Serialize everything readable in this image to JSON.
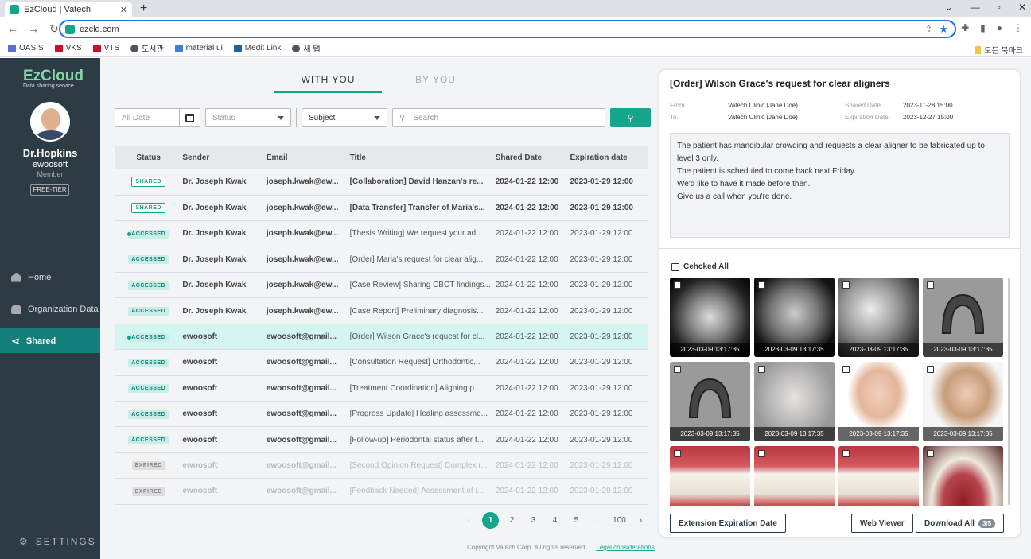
{
  "browser": {
    "tab_title": "EzCloud | Vatech",
    "url": "ezcld.com",
    "bookmarks": [
      "OASIS",
      "VKS",
      "VTS",
      "도서관",
      "material ui",
      "Medit Link",
      "새 탭"
    ],
    "bookmarks_right": "모든 북마크"
  },
  "sidebar": {
    "logo": "EzCloud",
    "tagline": "Data sharing service",
    "user_name": "Dr.Hopkins",
    "user_id": "ewoosoft",
    "role": "Member",
    "tier": "FREE-TIER",
    "nav": [
      {
        "label": "Home",
        "icon": "home-icon"
      },
      {
        "label": "Organization Data",
        "icon": "cloud-upload-icon"
      },
      {
        "label": "Shared",
        "icon": "share-icon",
        "active": true
      }
    ],
    "settings": "SETTINGS"
  },
  "main": {
    "tabs": [
      "WITH YOU",
      "BY YOU"
    ],
    "filters": {
      "date_placeholder": "All Date",
      "status": "Status",
      "subject": "Subject",
      "search_placeholder": "Search"
    },
    "columns": [
      "Status",
      "Sender",
      "Email",
      "Title",
      "Shared Date",
      "Expiration date"
    ],
    "rows": [
      {
        "status": "SHARED",
        "sender": "Dr. Joseph Kwak",
        "email": "joseph.kwak@ew...",
        "title": "[Collaboration] David Hanzan's re...",
        "shared": "2024-01-22 12:00",
        "exp": "2023-01-29 12:00",
        "bold": true
      },
      {
        "status": "SHARED",
        "sender": "Dr. Joseph Kwak",
        "email": "joseph.kwak@ew...",
        "title": "[Data Transfer] Transfer of Maria's...",
        "shared": "2024-01-22 12:00",
        "exp": "2023-01-29 12:00",
        "bold": true
      },
      {
        "status": "ACCESSED",
        "sender": "Dr. Joseph Kwak",
        "email": "joseph.kwak@ew...",
        "title": "[Thesis Writing] We request your ad...",
        "shared": "2024-01-22 12:00",
        "exp": "2023-01-29 12:00",
        "dot": true
      },
      {
        "status": "ACCESSED",
        "sender": "Dr. Joseph Kwak",
        "email": "joseph.kwak@ew...",
        "title": "[Order] Maria's request for clear alig...",
        "shared": "2024-01-22 12:00",
        "exp": "2023-01-29 12:00"
      },
      {
        "status": "ACCESSED",
        "sender": "Dr. Joseph Kwak",
        "email": "joseph.kwak@ew...",
        "title": "[Case Review] Sharing CBCT findings...",
        "shared": "2024-01-22 12:00",
        "exp": "2023-01-29 12:00"
      },
      {
        "status": "ACCESSED",
        "sender": "Dr. Joseph Kwak",
        "email": "joseph.kwak@ew...",
        "title": "[Case Report] Preliminary diagnosis...",
        "shared": "2024-01-22 12:00",
        "exp": "2023-01-29 12:00"
      },
      {
        "status": "ACCESSED",
        "sender": "ewoosoft",
        "email": "ewoosoft@gmail...",
        "title": "[Order] Wilson Grace's request for cl...",
        "shared": "2024-01-22 12:00",
        "exp": "2023-01-29 12:00",
        "dot": true,
        "selected": true
      },
      {
        "status": "ACCESSED",
        "sender": "ewoosoft",
        "email": "ewoosoft@gmail...",
        "title": "[Consultation Request] Orthodontic...",
        "shared": "2024-01-22 12:00",
        "exp": "2023-01-29 12:00"
      },
      {
        "status": "ACCESSED",
        "sender": "ewoosoft",
        "email": "ewoosoft@gmail...",
        "title": "[Treatment Coordination] Aligning p...",
        "shared": "2024-01-22 12:00",
        "exp": "2023-01-29 12:00"
      },
      {
        "status": "ACCESSED",
        "sender": "ewoosoft",
        "email": "ewoosoft@gmail...",
        "title": "[Progress Update] Healing assessme...",
        "shared": "2024-01-22 12:00",
        "exp": "2023-01-29 12:00"
      },
      {
        "status": "ACCESSED",
        "sender": "ewoosoft",
        "email": "ewoosoft@gmail...",
        "title": "[Follow-up] Periodontal status after f...",
        "shared": "2024-01-22 12:00",
        "exp": "2023-01-29 12:00"
      },
      {
        "status": "EXPIRED",
        "sender": "ewoosoft",
        "email": "ewoosoft@gmail...",
        "title": "[Second Opinion Request] Complex r...",
        "shared": "2024-01-22 12:00",
        "exp": "2023-01-29 12:00"
      },
      {
        "status": "EXPIRED",
        "sender": "ewoosoft",
        "email": "ewoosoft@gmail...",
        "title": "[Feedback Needed] Assessment of i...",
        "shared": "2024-01-22 12:00",
        "exp": "2023-01-29 12:00"
      }
    ],
    "pagination": [
      "1",
      "2",
      "3",
      "4",
      "5",
      "...",
      "100"
    ],
    "footer_copy": "Copyright Vatech Corp. All rights reserved",
    "footer_link": "Legal considerations"
  },
  "detail": {
    "title": "[Order] Wilson Grace's request for clear aligners",
    "from_label": "From.",
    "from": "Vatech Clinic (Jane Doe)",
    "to_label": "To.",
    "to": "Vatech Clinic (Jane Doe)",
    "shared_label": "Shared Date.",
    "shared": "2023-11-28 15:00",
    "exp_label": "Expiration Date.",
    "exp": "2023-12-27 15:00",
    "message": [
      "The patient has mandibular crowding and requests a clear aligner to be fabricated up to level 3 only.",
      "The patient is scheduled to come back next Friday.",
      "We'd like to have it made before then.",
      "Give us a call when you're done."
    ],
    "check_all": "Cehcked All",
    "thumbs": [
      {
        "ts": "2023-03-09 13:17:35",
        "kind": "panoramic-xray"
      },
      {
        "ts": "2023-03-09 13:17:35",
        "kind": "ceph-xray"
      },
      {
        "ts": "2023-03-09 13:17:35",
        "kind": "intraoral-xray"
      },
      {
        "ts": "2023-03-09 13:17:35",
        "kind": "upper-model"
      },
      {
        "ts": "2023-03-09 13:17:35",
        "kind": "lower-model"
      },
      {
        "ts": "2023-03-09 13:17:35",
        "kind": "face-mesh"
      },
      {
        "ts": "2023-03-09 13:17:35",
        "kind": "face-front-photo"
      },
      {
        "ts": "2023-03-09 13:17:35",
        "kind": "face-side-photo"
      },
      {
        "kind": "teeth-photo"
      },
      {
        "kind": "teeth-photo"
      },
      {
        "kind": "teeth-photo"
      },
      {
        "kind": "occlusal-photo"
      }
    ],
    "btn_extend": "Extension Expiration Date",
    "btn_viewer": "Web Viewer",
    "btn_download": "Download All",
    "download_count": "3/5"
  }
}
